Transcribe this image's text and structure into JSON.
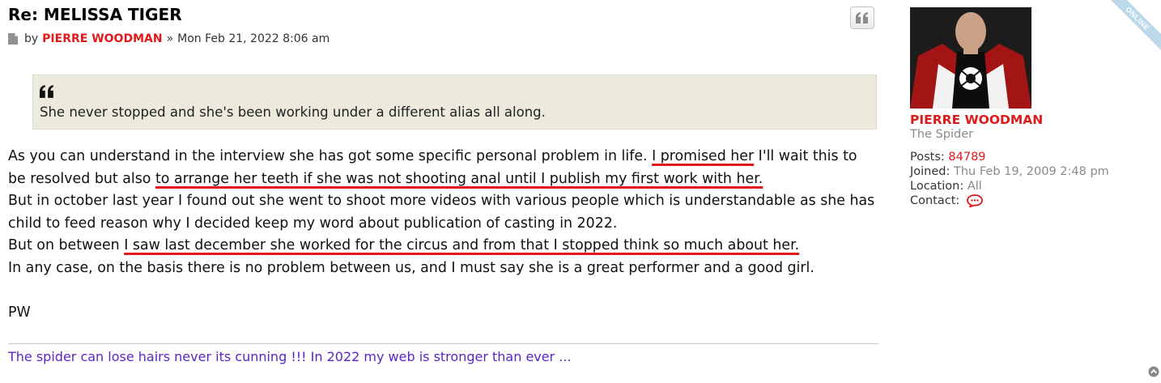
{
  "post": {
    "title": "Re: MELISSA TIGER",
    "by_label": "by",
    "author": "PIERRE WOODMAN",
    "separator": "»",
    "datetime": "Mon Feb 21, 2022 8:06 am",
    "quote_button_icon": "quote-icon",
    "blockquote": {
      "icon": "quote-left-icon",
      "text": "She never stopped and she's been working under a different alias all along."
    },
    "body": {
      "l1_a": "As you can understand in the interview she has got some specific personal problem in life. ",
      "l1_u": "I promised her",
      "l1_b": " I'll wait this to",
      "l2_a": "be resolved but also ",
      "l2_u": "to arrange her teeth if she was not shooting anal until I publish my first work with her.",
      "l3": "But in october last year I found out she went to shoot more videos with various people which is understandable as she has",
      "l4": "child to feed reason why I decided keep my word about publication of casting in 2022.",
      "l5_a": "But on between ",
      "l5_u": "I saw last december she worked for the circus and from that I stopped think so much about her.",
      "l6": "In any case, on the basis there is no problem between us, and I must say she is a great performer and a good girl.",
      "l7": "PW"
    },
    "signature": "The spider can lose hairs never its cunning !!! In 2022 my web is stronger than ever ..."
  },
  "profile": {
    "username": "PIERRE WOODMAN",
    "rank": "The Spider",
    "posts_label": "Posts:",
    "posts_value": "84789",
    "joined_label": "Joined:",
    "joined_value": "Thu Feb 19, 2009 2:48 pm",
    "location_label": "Location:",
    "location_value": "All",
    "contact_label": "Contact:",
    "contact_icon": "chat-bubble-icon",
    "online_badge": "ONLINE"
  },
  "colors": {
    "author_red": "#e01a1a",
    "quote_bg": "#ebeadd",
    "signature_purple": "#5a25c4",
    "underline_red": "#e01a1a"
  }
}
